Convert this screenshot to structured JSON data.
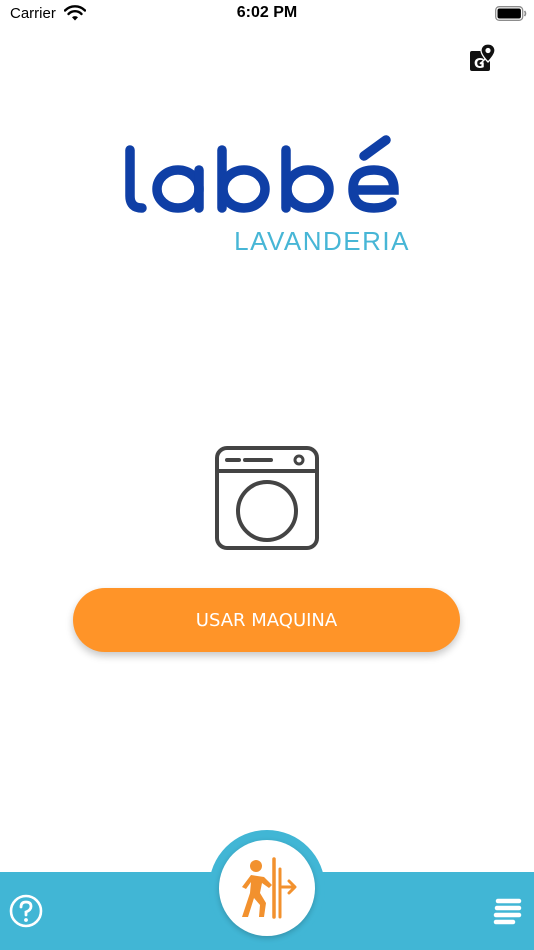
{
  "status_bar": {
    "carrier": "Carrier",
    "time": "6:02 PM",
    "wifi_icon": "wifi-icon",
    "battery_icon": "battery-icon"
  },
  "header": {
    "map_icon": "map-location-icon"
  },
  "logo": {
    "word": "labbé",
    "subtitle": "LAVANDERIA",
    "primary_color": "#0f3fa6",
    "secondary_color": "#47b6d6"
  },
  "main": {
    "machine_icon": "washing-machine-icon",
    "use_machine_label": "USAR MAQUINA",
    "button_color": "#ff9428"
  },
  "bottom_bar": {
    "color": "#41b6d5",
    "help_icon": "help-icon",
    "exit_icon": "exit-door-icon",
    "menu_icon": "menu-icon"
  }
}
